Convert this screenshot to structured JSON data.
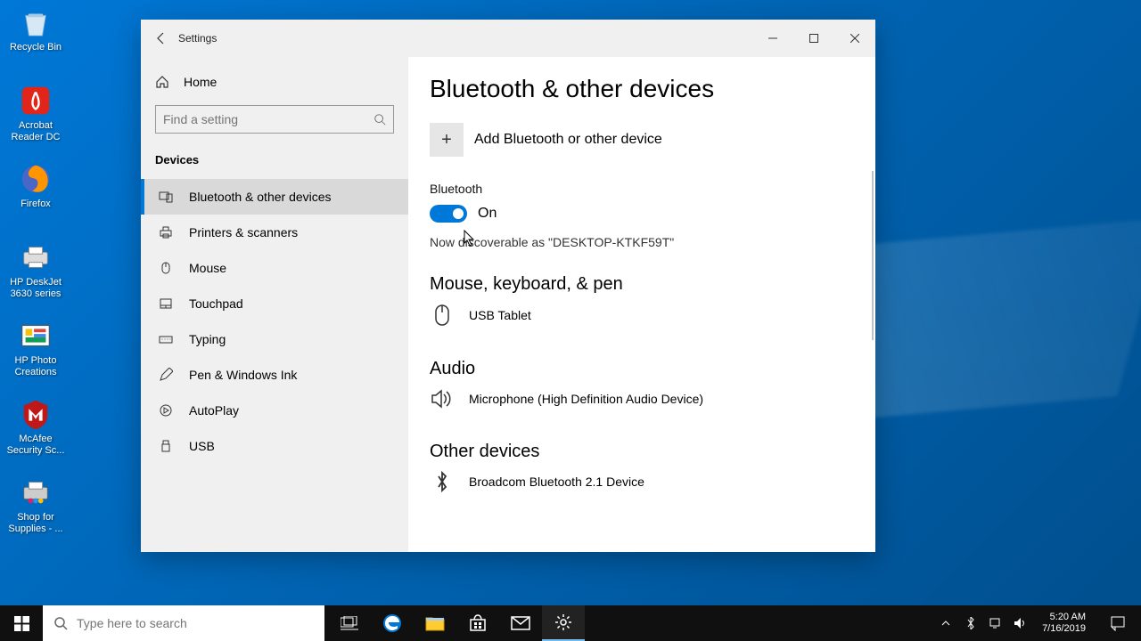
{
  "desktop": {
    "icons": [
      {
        "label": "Recycle Bin",
        "name": "recycle-bin"
      },
      {
        "label": "Acrobat Reader DC",
        "name": "acrobat"
      },
      {
        "label": "Firefox",
        "name": "firefox"
      },
      {
        "label": "HP DeskJet 3630 series",
        "name": "hp-deskjet"
      },
      {
        "label": "HP Photo Creations",
        "name": "hp-photo"
      },
      {
        "label": "McAfee Security Sc...",
        "name": "mcafee"
      },
      {
        "label": "Shop for Supplies - ...",
        "name": "shop-supplies"
      }
    ]
  },
  "window": {
    "title": "Settings",
    "home_label": "Home",
    "search_placeholder": "Find a setting",
    "section_title": "Devices",
    "nav_items": [
      {
        "label": "Bluetooth & other devices",
        "name": "nav-bluetooth",
        "active": true
      },
      {
        "label": "Printers & scanners",
        "name": "nav-printers"
      },
      {
        "label": "Mouse",
        "name": "nav-mouse"
      },
      {
        "label": "Touchpad",
        "name": "nav-touchpad"
      },
      {
        "label": "Typing",
        "name": "nav-typing"
      },
      {
        "label": "Pen & Windows Ink",
        "name": "nav-pen"
      },
      {
        "label": "AutoPlay",
        "name": "nav-autoplay"
      },
      {
        "label": "USB",
        "name": "nav-usb"
      }
    ]
  },
  "content": {
    "page_title": "Bluetooth & other devices",
    "add_device_label": "Add Bluetooth or other device",
    "bt_label": "Bluetooth",
    "bt_state": "On",
    "discoverable_text": "Now discoverable as \"DESKTOP-KTKF59T\"",
    "group_mouse": "Mouse, keyboard, & pen",
    "device_mouse": "USB Tablet",
    "group_audio": "Audio",
    "device_audio": "Microphone (High Definition Audio Device)",
    "group_other": "Other devices",
    "device_other": "Broadcom Bluetooth 2.1 Device"
  },
  "taskbar": {
    "search_placeholder": "Type here to search",
    "time": "5:20 AM",
    "date": "7/16/2019"
  }
}
